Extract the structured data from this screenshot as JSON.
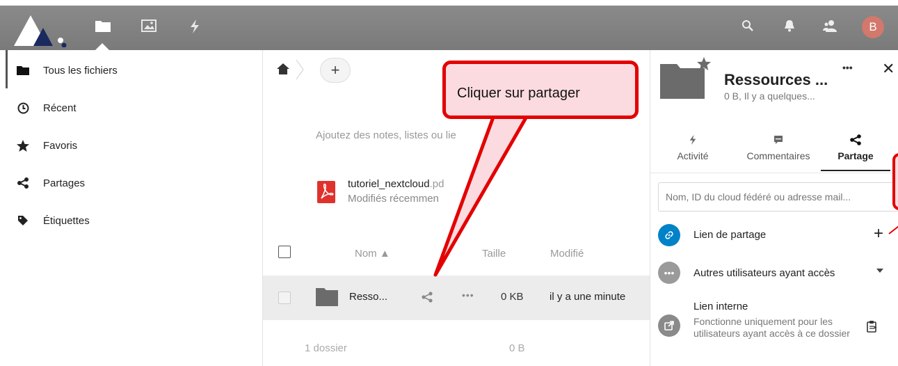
{
  "header": {
    "nav_icons": [
      "files-icon",
      "photos-icon",
      "activity-icon"
    ],
    "right_icons": [
      "search-icon",
      "notifications-icon",
      "contacts-icon"
    ],
    "avatar_letter": "B",
    "bar_color": "#808080",
    "avatar_color": "#d2786c"
  },
  "leftnav": {
    "items": [
      {
        "label": "Tous les fichiers",
        "icon": "folder-icon"
      },
      {
        "label": "Récent",
        "icon": "clock-icon"
      },
      {
        "label": "Favoris",
        "icon": "star-icon"
      },
      {
        "label": "Partages",
        "icon": "share-icon"
      },
      {
        "label": "Étiquettes",
        "icon": "tag-icon"
      }
    ]
  },
  "main": {
    "add_label": "+",
    "notes_hint": "Ajoutez des notes, listes ou lie",
    "recent": {
      "name": "tutoriel_nextcloud",
      "ext": ".pd",
      "subtitle": "Modifiés récemmen"
    },
    "columns": {
      "name": "Nom ▲",
      "size": "Taille",
      "modified": "Modifié"
    },
    "rows": [
      {
        "name": "Resso...",
        "more": "•••",
        "size": "0 KB",
        "modified": "il y a une minute"
      }
    ],
    "summary": {
      "count": "1 dossier",
      "size": "0 B"
    }
  },
  "sidebar": {
    "title": "Ressources ...",
    "subtitle": "0 B, Il y a quelques...",
    "more": "•••",
    "close": "✕",
    "tabs": [
      {
        "label": "Activité",
        "icon": "activity-icon"
      },
      {
        "label": "Commentaires",
        "icon": "comment-icon"
      },
      {
        "label": "Partage",
        "icon": "share-icon",
        "active": true
      }
    ],
    "search_placeholder": "Nom, ID du cloud fédéré ou adresse mail...",
    "share_link_label": "Lien de partage",
    "add_share_label": "+",
    "others_label": "Autres utilisateurs ayant accès",
    "internal_link_title": "Lien interne",
    "internal_link_desc": "Fonctionne uniquement pour les utilisateurs ayant accès à ce dossier",
    "link_color": "#0082c9"
  },
  "annotation": {
    "callout_text": "Cliquer sur partager",
    "border_color": "#e30000",
    "fill_color": "#fcdbe0"
  }
}
